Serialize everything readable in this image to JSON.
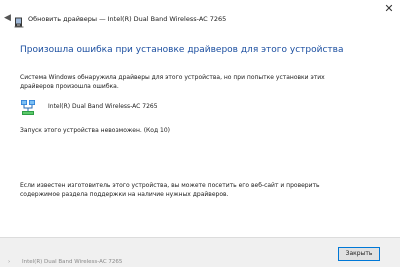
{
  "window": {
    "title": "Обновить драйверы — Intel(R) Dual Band Wireless-AC 7265",
    "close_glyph": "✕",
    "back_glyph": "◀"
  },
  "content": {
    "heading": "Произошла ошибка при установке драйверов для этого устройства",
    "detected_text": "Система Windows обнаружила драйверы для этого устройства, но при попытке установки этих драйверов произошла ошибка.",
    "device_name": "Intel(R) Dual Band Wireless-AC 7265",
    "error_status": "Запуск этого устройства невозможен. (Код 10)",
    "manufacturer_text": "Если известен изготовитель этого устройства, вы можете посетить его веб-сайт и проверить содержимое раздела поддержки на наличие нужных драйверов."
  },
  "footer": {
    "close_label": "Закрыть"
  },
  "background": {
    "chevron": "›",
    "partial_text": "Intel(R) Dual Band Wireless-AC 7265"
  },
  "colors": {
    "heading": "#1c4fa0",
    "button_border": "#0078d7",
    "footer_bg": "#f0f0f0"
  },
  "icons": {
    "title_icon": "device-manager-icon",
    "device_icon": "network-adapter-icon"
  }
}
